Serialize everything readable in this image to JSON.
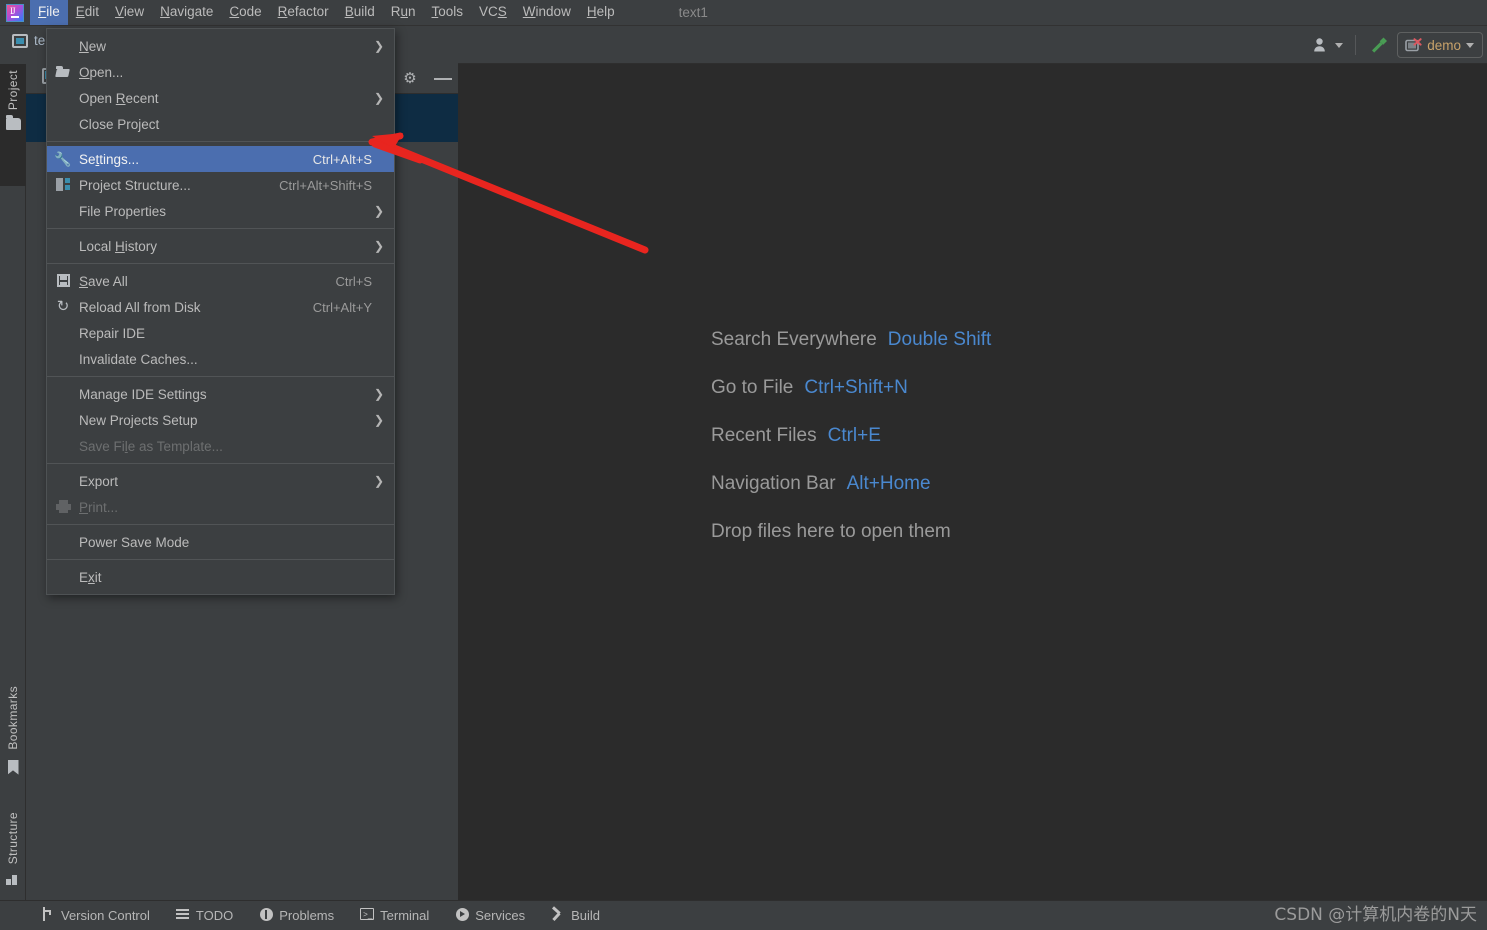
{
  "window": {
    "title": "text1",
    "logo_icon": "intellij-idea-logo"
  },
  "menubar": {
    "items": [
      {
        "label": "File",
        "mnemonic": "F",
        "active": true
      },
      {
        "label": "Edit",
        "mnemonic": "E",
        "active": false
      },
      {
        "label": "View",
        "mnemonic": "V",
        "active": false
      },
      {
        "label": "Navigate",
        "mnemonic": "N",
        "active": false
      },
      {
        "label": "Code",
        "mnemonic": "C",
        "active": false
      },
      {
        "label": "Refactor",
        "mnemonic": "R",
        "active": false
      },
      {
        "label": "Build",
        "mnemonic": "B",
        "active": false
      },
      {
        "label": "Run",
        "mnemonic": "u",
        "active": false
      },
      {
        "label": "Tools",
        "mnemonic": "T",
        "active": false
      },
      {
        "label": "VCS",
        "mnemonic": "S",
        "active": false
      },
      {
        "label": "Window",
        "mnemonic": "W",
        "active": false
      },
      {
        "label": "Help",
        "mnemonic": "H",
        "active": false
      }
    ]
  },
  "toolbar": {
    "account_icon": "person-icon",
    "build_icon": "hammer-icon",
    "run_config": {
      "label": "demo",
      "icon": "run-config-error-icon",
      "caret_icon": "chevron-down-icon"
    }
  },
  "project_tab": {
    "label": "te",
    "icon": "project-window-icon"
  },
  "tool_window": {
    "gear_icon": "gear-icon",
    "hide_icon": "minimize-icon",
    "selected_node_icon": "module-icon"
  },
  "left_stripe": {
    "project": {
      "label": "Project",
      "icon": "folder-icon"
    },
    "bookmarks": {
      "label": "Bookmarks",
      "icon": "bookmark-icon"
    },
    "structure": {
      "label": "Structure",
      "icon": "structure-icon"
    }
  },
  "file_menu": {
    "items": [
      {
        "label": "New",
        "mnemonic": "N",
        "shortcut": "",
        "submenu": true,
        "icon": "",
        "disabled": false,
        "selected": false,
        "separator_after": false
      },
      {
        "label": "Open...",
        "mnemonic": "O",
        "shortcut": "",
        "submenu": false,
        "icon": "folder-open-icon",
        "disabled": false,
        "selected": false,
        "separator_after": false
      },
      {
        "label": "Open Recent",
        "mnemonic": "R",
        "shortcut": "",
        "submenu": true,
        "icon": "",
        "disabled": false,
        "selected": false,
        "separator_after": false
      },
      {
        "label": "Close Project",
        "mnemonic": "",
        "shortcut": "",
        "submenu": false,
        "icon": "",
        "disabled": false,
        "selected": false,
        "separator_after": true
      },
      {
        "label": "Settings...",
        "mnemonic": "t",
        "shortcut": "Ctrl+Alt+S",
        "submenu": false,
        "icon": "wrench-icon",
        "disabled": false,
        "selected": true,
        "separator_after": false
      },
      {
        "label": "Project Structure...",
        "mnemonic": "",
        "shortcut": "Ctrl+Alt+Shift+S",
        "submenu": false,
        "icon": "project-structure-icon",
        "disabled": false,
        "selected": false,
        "separator_after": false
      },
      {
        "label": "File Properties",
        "mnemonic": "",
        "shortcut": "",
        "submenu": true,
        "icon": "",
        "disabled": false,
        "selected": false,
        "separator_after": true
      },
      {
        "label": "Local History",
        "mnemonic": "H",
        "shortcut": "",
        "submenu": true,
        "icon": "",
        "disabled": false,
        "selected": false,
        "separator_after": true
      },
      {
        "label": "Save All",
        "mnemonic": "S",
        "shortcut": "Ctrl+S",
        "submenu": false,
        "icon": "save-icon",
        "disabled": false,
        "selected": false,
        "separator_after": false
      },
      {
        "label": "Reload All from Disk",
        "mnemonic": "",
        "shortcut": "Ctrl+Alt+Y",
        "submenu": false,
        "icon": "refresh-icon",
        "disabled": false,
        "selected": false,
        "separator_after": false
      },
      {
        "label": "Repair IDE",
        "mnemonic": "",
        "shortcut": "",
        "submenu": false,
        "icon": "",
        "disabled": false,
        "selected": false,
        "separator_after": false
      },
      {
        "label": "Invalidate Caches...",
        "mnemonic": "",
        "shortcut": "",
        "submenu": false,
        "icon": "",
        "disabled": false,
        "selected": false,
        "separator_after": true
      },
      {
        "label": "Manage IDE Settings",
        "mnemonic": "",
        "shortcut": "",
        "submenu": true,
        "icon": "",
        "disabled": false,
        "selected": false,
        "separator_after": false
      },
      {
        "label": "New Projects Setup",
        "mnemonic": "",
        "shortcut": "",
        "submenu": true,
        "icon": "",
        "disabled": false,
        "selected": false,
        "separator_after": false
      },
      {
        "label": "Save File as Template...",
        "mnemonic": "l",
        "shortcut": "",
        "submenu": false,
        "icon": "",
        "disabled": true,
        "selected": false,
        "separator_after": true
      },
      {
        "label": "Export",
        "mnemonic": "",
        "shortcut": "",
        "submenu": true,
        "icon": "",
        "disabled": false,
        "selected": false,
        "separator_after": false
      },
      {
        "label": "Print...",
        "mnemonic": "P",
        "shortcut": "",
        "submenu": false,
        "icon": "printer-icon",
        "disabled": true,
        "selected": false,
        "separator_after": true
      },
      {
        "label": "Power Save Mode",
        "mnemonic": "",
        "shortcut": "",
        "submenu": false,
        "icon": "",
        "disabled": false,
        "selected": false,
        "separator_after": true
      },
      {
        "label": "Exit",
        "mnemonic": "x",
        "shortcut": "",
        "submenu": false,
        "icon": "",
        "disabled": false,
        "selected": false,
        "separator_after": false
      }
    ]
  },
  "editor_hints": [
    {
      "label": "Search Everywhere",
      "key": "Double Shift"
    },
    {
      "label": "Go to File",
      "key": "Ctrl+Shift+N"
    },
    {
      "label": "Recent Files",
      "key": "Ctrl+E"
    },
    {
      "label": "Navigation Bar",
      "key": "Alt+Home"
    },
    {
      "label": "Drop files here to open them",
      "key": ""
    }
  ],
  "status_bar": {
    "items": [
      {
        "label": "Version Control",
        "icon": "branch-icon"
      },
      {
        "label": "TODO",
        "icon": "list-icon"
      },
      {
        "label": "Problems",
        "icon": "exclamation-circle-icon"
      },
      {
        "label": "Terminal",
        "icon": "terminal-icon"
      },
      {
        "label": "Services",
        "icon": "play-circle-icon"
      },
      {
        "label": "Build",
        "icon": "hammer-icon"
      }
    ],
    "watermark": "CSDN @计算机内卷的N天"
  },
  "annotation": {
    "color": "#e8251f",
    "type": "arrow",
    "points": "from (645,250) to (375,140)"
  },
  "colors": {
    "menu_bg": "#3c3f41",
    "editor_bg": "#2b2b2b",
    "selection_blue": "#4b6eaf",
    "tree_selection": "#0e2c43",
    "hint_key_blue": "#4a88cf",
    "text_primary": "#bbbbbb",
    "text_disabled": "#6d6f70",
    "run_config_text": "#c8a26a",
    "annotation_red": "#e8251f"
  }
}
